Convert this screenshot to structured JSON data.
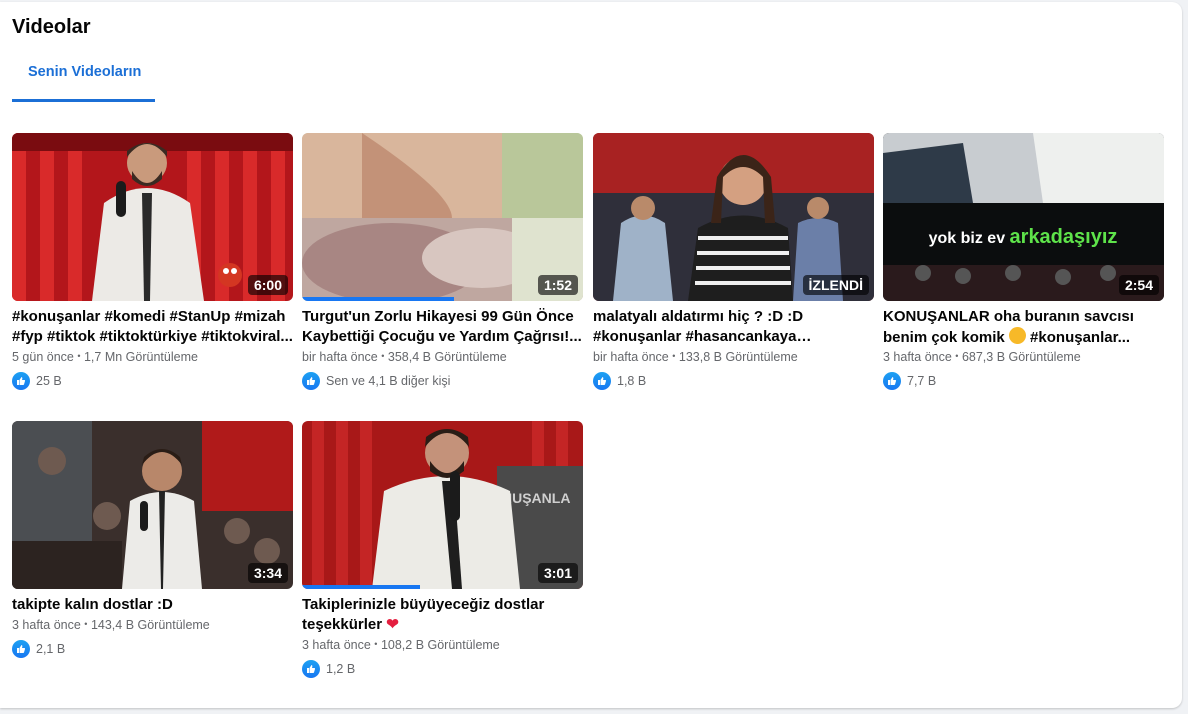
{
  "page": {
    "title": "Videolar"
  },
  "tabs": [
    {
      "label": "Senin Videoların",
      "active": true
    }
  ],
  "accent_color": "#1b6fd6",
  "videos": [
    {
      "duration": "6:00",
      "title": "#konuşanlar #komedi #StanUp #mizah #fyp #tiktok #tiktoktürkiye #tiktokviral...",
      "age": "5 gün önce",
      "views": "1,7 Mn Görüntüleme",
      "likes": "25 B"
    },
    {
      "duration": "1:52",
      "title": "Turgut'un Zorlu Hikayesi 99 Gün Önce Kaybettiği Çocuğu ve Yardım Çağrısı!...",
      "age": "bir hafta önce",
      "views": "358,4 B Görüntüleme",
      "likes": "Sen ve 4,1 B diğer kişi",
      "watch_progress": 0.54
    },
    {
      "duration": "İZLENDİ",
      "title": "malatyalı aldatırmı hiç ? :D :D #konuşanlar #hasancankaya #konusanl...",
      "age": "bir hafta önce",
      "views": "133,8 B Görüntüleme",
      "likes": "1,8 B"
    },
    {
      "duration": "2:54",
      "title": "KONUŞANLAR oha buranın savcısı benim çok komik",
      "title_suffix": " #konuşanlar...",
      "age": "3 hafta önce",
      "views": "687,3 B Görüntüleme",
      "likes": "7,7 B",
      "overlay_text": "yok biz ev arkadaşıyız"
    },
    {
      "duration": "3:34",
      "title": "takipte kalın dostlar :D",
      "age": "3 hafta önce",
      "views": "143,4 B Görüntüleme",
      "likes": "2,1 B"
    },
    {
      "duration": "3:01",
      "title": "Takiplerinizle büyüyeceğiz dostlar teşekkürler",
      "age": "3 hafta önce",
      "views": "108,2 B Görüntüleme",
      "likes": "1,2 B",
      "watch_progress": 0.42,
      "overlay_text": "NUŞANLA"
    }
  ]
}
